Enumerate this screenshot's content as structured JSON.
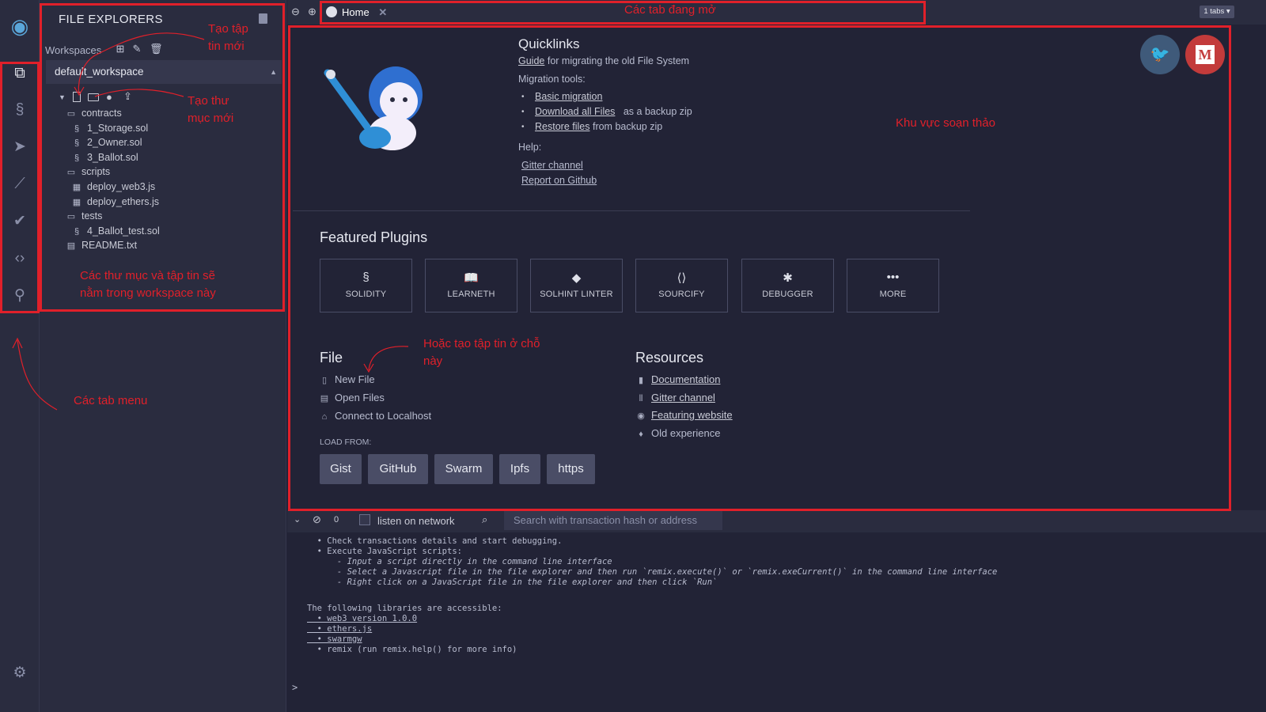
{
  "explorer": {
    "title": "FILE EXPLORERS",
    "workspaces_label": "Workspaces",
    "selected_workspace": "default_workspace",
    "tree": [
      {
        "name": "contracts",
        "type": "folder",
        "icon": "folder-icon"
      },
      {
        "name": "1_Storage.sol",
        "type": "file",
        "icon": "solidity-icon"
      },
      {
        "name": "2_Owner.sol",
        "type": "file",
        "icon": "solidity-icon"
      },
      {
        "name": "3_Ballot.sol",
        "type": "file",
        "icon": "solidity-icon"
      },
      {
        "name": "scripts",
        "type": "folder",
        "icon": "folder-icon"
      },
      {
        "name": "deploy_web3.js",
        "type": "file",
        "icon": "js-icon"
      },
      {
        "name": "deploy_ethers.js",
        "type": "file",
        "icon": "js-icon"
      },
      {
        "name": "tests",
        "type": "folder",
        "icon": "folder-icon"
      },
      {
        "name": "4_Ballot_test.sol",
        "type": "file",
        "icon": "solidity-icon"
      },
      {
        "name": "README.txt",
        "type": "file",
        "icon": "text-file-icon"
      }
    ]
  },
  "tabs": {
    "home_label": "Home",
    "count_label": "1 tabs"
  },
  "home": {
    "quicklinks_title": "Quicklinks",
    "guide_link": "Guide",
    "guide_text": "for migrating the old File System",
    "migration_label": "Migration tools:",
    "migration_items": [
      {
        "link": "Basic migration",
        "text": ""
      },
      {
        "link": "Download all Files",
        "text": "as a backup zip"
      },
      {
        "link": "Restore files",
        "text": "from backup zip"
      }
    ],
    "help_label": "Help:",
    "help_links": [
      "Gitter channel",
      "Report on Github"
    ],
    "featured_title": "Featured Plugins",
    "plugins": [
      {
        "label": "SOLIDITY",
        "icon": "solidity-icon"
      },
      {
        "label": "LEARNETH",
        "icon": "book-reader-icon"
      },
      {
        "label": "SOLHINT LINTER",
        "icon": "diamond-check-icon"
      },
      {
        "label": "SOURCIFY",
        "icon": "code-box-icon"
      },
      {
        "label": "DEBUGGER",
        "icon": "bug-icon"
      },
      {
        "label": "MORE",
        "icon": "ellipsis-icon"
      }
    ],
    "file_title": "File",
    "file_actions": [
      {
        "label": "New File",
        "icon": "file-icon"
      },
      {
        "label": "Open Files",
        "icon": "open-file-icon"
      },
      {
        "label": "Connect to Localhost",
        "icon": "hdd-icon"
      }
    ],
    "load_from_label": "LOAD FROM:",
    "load_buttons": [
      "Gist",
      "GitHub",
      "Swarm",
      "Ipfs",
      "https"
    ],
    "resources_title": "Resources",
    "resources": [
      {
        "label": "Documentation",
        "icon": "book-icon",
        "link": true
      },
      {
        "label": "Gitter channel",
        "icon": "gitter-icon",
        "link": true
      },
      {
        "label": "Featuring website",
        "icon": "remix-icon",
        "link": true
      },
      {
        "label": "Old experience",
        "icon": "ethereum-icon",
        "link": false
      }
    ],
    "social": [
      {
        "name": "twitter",
        "glyph": "🐦",
        "color": "#3f5a7a"
      },
      {
        "name": "medium",
        "glyph": "M",
        "color": "#c33b3b"
      }
    ]
  },
  "terminal": {
    "pending_count": "0",
    "listen_label": "listen on network",
    "search_placeholder": "Search with transaction hash or address",
    "lines": [
      "  • Check transactions details and start debugging.",
      "  • Execute JavaScript scripts:",
      "      - Input a script directly in the command line interface",
      "      - Select a Javascript file in the file explorer and then run `remix.execute()` or `remix.exeCurrent()` in the command line interface",
      "      - Right click on a JavaScript file in the file explorer and then click `Run`",
      "The following libraries are accessible:",
      "  • web3 version 1.0.0",
      "  • ethers.js",
      "  • swarmgw",
      "  • remix (run remix.help() for more info)"
    ],
    "prompt": ">"
  },
  "annotations": {
    "new_file": "Tạo tập\ntin mới",
    "new_folder": "Tạo thư\nmục mới",
    "workspace_contents": "Các thư mục và tập tin sẽ\nnằm trong workspace này",
    "menu_tabs": "Các tab menu",
    "open_tabs": "Các tab đang mở",
    "editor_area": "Khu vực soạn thảo",
    "or_create_here": "Hoặc tạo tập tin ở chỗ\nnày"
  },
  "colors": {
    "annotation_red": "#e0202a",
    "panel_bg": "#2a2c3f",
    "main_bg": "#222336"
  }
}
